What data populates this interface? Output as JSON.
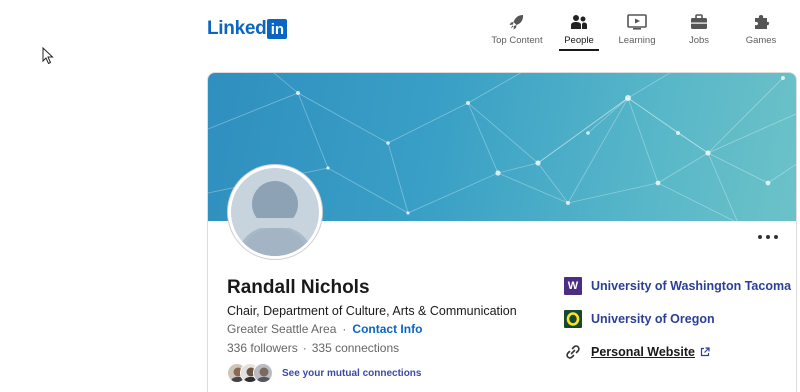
{
  "header": {
    "logo_text": "Linked",
    "logo_box": "in",
    "nav": [
      {
        "label": "Top Content",
        "icon": "rocket-icon"
      },
      {
        "label": "People",
        "icon": "people-icon",
        "active": true
      },
      {
        "label": "Learning",
        "icon": "learning-icon"
      },
      {
        "label": "Jobs",
        "icon": "briefcase-icon"
      },
      {
        "label": "Games",
        "icon": "puzzle-icon"
      }
    ]
  },
  "profile": {
    "name": "Randall Nichols",
    "headline": "Chair, Department of Culture, Arts & Communication",
    "location": "Greater Seattle Area",
    "separator": "·",
    "contact_info": "Contact Info",
    "followers": "336 followers",
    "connections": "335 connections",
    "mutual_connections": "See your mutual connections"
  },
  "sidebar": {
    "education": [
      {
        "name": "University of Washington Tacoma",
        "logo_letter": "W",
        "logo_color": "#4b2e83"
      },
      {
        "name": "University of Oregon",
        "logo_letter": "O",
        "logo_color": "#154733"
      }
    ],
    "website_label": "Personal Website"
  },
  "colors": {
    "brand": "#0a66c2",
    "link": "#2b3f97",
    "banner_start": "#2f8fbf",
    "banner_end": "#6cc2c8"
  }
}
